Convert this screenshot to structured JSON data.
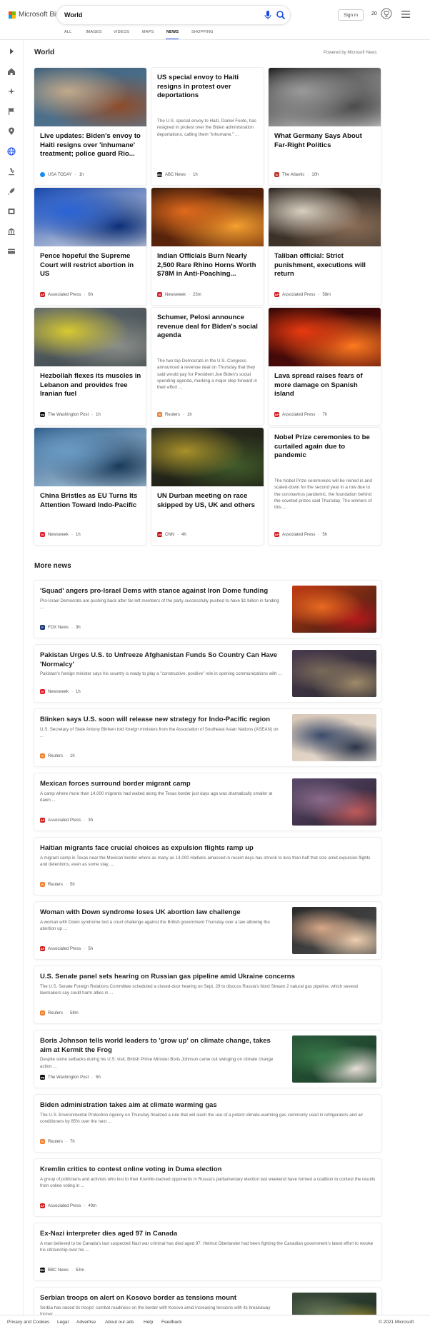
{
  "header": {
    "brand": "Microsoft Bing",
    "search_value": "World",
    "signin_label": "Sign in",
    "points": "20",
    "logo_colors": [
      "#f25022",
      "#7fba00",
      "#00a4ef",
      "#ffb900"
    ],
    "accent_color": "#174ae4"
  },
  "tabs": [
    "ALL",
    "IMAGES",
    "VIDEOS",
    "MAPS",
    "NEWS",
    "SHOPPING"
  ],
  "active_tab": "NEWS",
  "sidebar_icons": [
    "expand-icon",
    "home-icon",
    "sparkles-icon",
    "flag-icon",
    "location-icon",
    "globe-icon",
    "microscope-icon",
    "rocket-icon",
    "film-icon",
    "bank-icon",
    "card-icon"
  ],
  "world": {
    "title": "World",
    "powered_by": "Powered by Microsoft News",
    "cards": [
      {
        "title": "Live updates: Biden's envoy to Haiti resigns over 'inhumane' treatment; police guard Rio...",
        "source": "USA TODAY",
        "time": "1h",
        "badge_color": "#1a8bf0",
        "badge_text": "",
        "image_colors": [
          "#3b5e7c",
          "#c2a98a",
          "#8e4b2a",
          "#5a7d96"
        ]
      },
      {
        "title": "US special envoy to Haiti resigns in protest over deportations",
        "snippet": "The U.S. special envoy to Haiti, Daniel Foote, has resigned in protest over the Biden administration deportations, calling them \"inhumane.\" ...",
        "source": "ABC News",
        "time": "1h",
        "badge_color": "#222",
        "badge_text": "abc"
      },
      {
        "title": "What Germany Says About Far-Right Politics",
        "source": "The Atlantic",
        "time": "10h",
        "badge_color": "#c0392b",
        "badge_text": "A",
        "image_colors": [
          "#1c1c1c",
          "#9a9a9a",
          "#4b4b4b",
          "#d8d8d8"
        ]
      },
      {
        "title": "Pence hopeful the Supreme Court will restrict abortion in US",
        "source": "Associated Press",
        "time": "6h",
        "badge_color": "#d01f1f",
        "badge_text": "AP",
        "image_colors": [
          "#1846a8",
          "#2a63d4",
          "#0d2f78",
          "#e8e8e8"
        ]
      },
      {
        "title": "Indian Officials Burn Nearly 2,500 Rare Rhino Horns Worth $78M in Anti-Poaching...",
        "source": "Newsweek",
        "time": "23m",
        "badge_color": "#e0212b",
        "badge_text": "N",
        "image_colors": [
          "#3a1a0c",
          "#e06a1c",
          "#f5a030",
          "#6e2a0a"
        ]
      },
      {
        "title": "Taliban official: Strict punishment, executions will return",
        "source": "Associated Press",
        "time": "58m",
        "badge_color": "#d01f1f",
        "badge_text": "AP",
        "image_colors": [
          "#2c2520",
          "#d8cfc0",
          "#8a6e58",
          "#4a3c30"
        ]
      },
      {
        "title": "Hezbollah flexes its muscles in Lebanon and provides free Iranian fuel",
        "source": "The Washington Post",
        "time": "1h",
        "badge_color": "#111",
        "badge_text": "wp",
        "image_colors": [
          "#606a70",
          "#d8c930",
          "#8a8e8a",
          "#3c4448"
        ]
      },
      {
        "title": "Schumer, Pelosi announce revenue deal for Biden's social agenda",
        "snippet": "The two top Democrats in the U.S. Congress announced a revenue deal on Thursday that they said would pay for President Joe Biden's social spending agenda, marking a major step forward in their effort ...",
        "source": "Reuters",
        "time": "1h",
        "badge_color": "#f08030",
        "badge_text": "R"
      },
      {
        "title": "Lava spread raises fears of more damage on Spanish island",
        "source": "Associated Press",
        "time": "7h",
        "badge_color": "#d01f1f",
        "badge_text": "AP",
        "image_colors": [
          "#2a0606",
          "#e83a10",
          "#ff7a20",
          "#5a0c0c"
        ]
      },
      {
        "title": "China Bristles as EU Turns Its Attention Toward Indo-Pacific",
        "source": "Newsweek",
        "time": "1h",
        "badge_color": "#e0212b",
        "badge_text": "N",
        "image_colors": [
          "#2e5d8a",
          "#6a9bc4",
          "#1a3a5a",
          "#b8d0e2"
        ]
      },
      {
        "title": "UN Durban meeting on race skipped by US, UK and others",
        "source": "CNN",
        "time": "4h",
        "badge_color": "#cc0000",
        "badge_text": "CNN",
        "image_colors": [
          "#2e3020",
          "#a8902a",
          "#405a2a",
          "#1a1a14"
        ]
      },
      {
        "title": "Nobel Prize ceremonies to be curtailed again due to pandemic",
        "snippet": "The Nobel Prize ceremonies will be reined in and scaled-down for the second year in a row due to the coronavirus pandemic, the foundation behind the coveted prizes said Thursday. The winners of this ...",
        "source": "Associated Press",
        "time": "5h",
        "badge_color": "#d01f1f",
        "badge_text": "AP"
      }
    ]
  },
  "more_news": {
    "title": "More news",
    "items": [
      {
        "title": "'Squad' angers pro-Israel Dems with stance against Iron Dome funding",
        "snippet": "Pro-Israel Democrats are pushing back after far-left members of the party successfully pushed to have $1 billion in funding ...",
        "source": "FOX News",
        "time": "3h",
        "badge_color": "#1b3a7a",
        "badge_text": "F",
        "image_colors": [
          "#c43a12",
          "#e86a20",
          "#2a1a14",
          "#b31a1a"
        ]
      },
      {
        "title": "Pakistan Urges U.S. to Unfreeze Afghanistan Funds So Country Can Have 'Normalcy'",
        "snippet": "Pakistan's foreign minister says his country is ready to play a \"constructive, positive\" role in opening communications with ...",
        "source": "Newsweek",
        "time": "1h",
        "badge_color": "#e0212b",
        "badge_text": "N",
        "image_colors": [
          "#4a3a4e",
          "#7a6a5a",
          "#2a2a30",
          "#a08a6a"
        ]
      },
      {
        "title": "Blinken says U.S. soon will release new strategy for Indo-Pacific region",
        "snippet": "U.S. Secretary of State Antony Blinken told foreign ministers from the Association of Southeast Asian Nations (ASEAN) on ...",
        "source": "Reuters",
        "time": "1h",
        "badge_color": "#f08030",
        "badge_text": "R",
        "image_colors": [
          "#d8c8b8",
          "#3a4a6a",
          "#e8dcd0",
          "#2a3448"
        ]
      },
      {
        "title": "Mexican forces surround border migrant camp",
        "snippet": "A camp where more than 14,000 migrants had waited along the Texas border just days ago was dramatically smaller at dawn ...",
        "source": "Associated Press",
        "time": "3h",
        "badge_color": "#d01f1f",
        "badge_text": "AP",
        "image_colors": [
          "#5a4a6a",
          "#8a6a8a",
          "#2a2030",
          "#c05a5a"
        ]
      },
      {
        "title": "Haitian migrants face crucial choices as expulsion flights ramp up",
        "snippet": "A migrant camp in Texas near the Mexican border where as many as 14,000 Haitians amassed in recent days has shrunk to less than half that size amid expulsion flights and detentions, even as some stay, ...",
        "source": "Reuters",
        "time": "5h",
        "badge_color": "#f08030",
        "badge_text": "R"
      },
      {
        "title": "Woman with Down syndrome loses UK abortion law challenge",
        "snippet": "A woman with Down syndrome lost a court challenge against the British government Thursday over a law allowing the abortion up ...",
        "source": "Associated Press",
        "time": "5h",
        "badge_color": "#d01f1f",
        "badge_text": "AP",
        "image_colors": [
          "#2a2a2a",
          "#d8a888",
          "#505050",
          "#f0d0b0"
        ]
      },
      {
        "title": "U.S. Senate panel sets hearing on Russian gas pipeline amid Ukraine concerns",
        "snippet": "The U.S. Senate Foreign Relations Committee scheduled a closed-door hearing on Sept. 29 to discuss Russia's Nord Stream 2 natural gas pipeline, which several lawmakers say could harm allies in ...",
        "source": "Reuters",
        "time": "58m",
        "badge_color": "#f08030",
        "badge_text": "R"
      },
      {
        "title": "Boris Johnson tells world leaders to 'grow up' on climate change, takes aim at Kermit the Frog",
        "snippet": "Despite some setbacks during his U.S. visit, British Prime Minister Boris Johnson came out swinging on climate change action ...",
        "source": "The Washington Post",
        "time": "5h",
        "badge_color": "#111",
        "badge_text": "wp",
        "image_colors": [
          "#2a5a3a",
          "#3a7a4a",
          "#1a3a28",
          "#e8e0d8"
        ]
      },
      {
        "title": "Biden administration takes aim at climate warming gas",
        "snippet": "The U.S. Environmental Protection Agency on Thursday finalized a rule that will slash the use of a potent climate-warming gas commonly used in refrigerators and air conditioners by 85% over the next ...",
        "source": "Reuters",
        "time": "7h",
        "badge_color": "#f08030",
        "badge_text": "R"
      },
      {
        "title": "Kremlin critics to contest online voting in Duma election",
        "snippet": "A group of politicians and activists who lost to their Kremlin-backed opponents in Russia's parliamentary election last weekend have formed a coalition to contest the results from online voting in ...",
        "source": "Associated Press",
        "time": "49m",
        "badge_color": "#d01f1f",
        "badge_text": "AP"
      },
      {
        "title": "Ex-Nazi interpreter dies aged 97 in Canada",
        "snippet": "A man believed to be Canada's last suspected Nazi war criminal has died aged 97. Helmut Oberlander had been fighting the Canadian government's latest effort to revoke his citizenship over his ...",
        "source": "BBC News",
        "time": "53m",
        "badge_color": "#111",
        "badge_text": "BBC"
      },
      {
        "title": "Serbian troops on alert on Kosovo border as tensions mount",
        "snippet": "Serbia has raised its troops' combat readiness on the border with Kosovo amid increasing tensions with its breakaway former ...",
        "source": "Associated Press",
        "time": "22m",
        "badge_color": "#d01f1f",
        "badge_text": "AP",
        "image_colors": [
          "#3a4a3a",
          "#6a7a5a",
          "#1a2a20",
          "#c0a830"
        ]
      }
    ]
  },
  "footer": {
    "links": [
      "Privacy and Cookies",
      "Legal",
      "Advertise",
      "About our ads",
      "Help",
      "Feedback"
    ],
    "copyright": "© 2021 Microsoft"
  }
}
